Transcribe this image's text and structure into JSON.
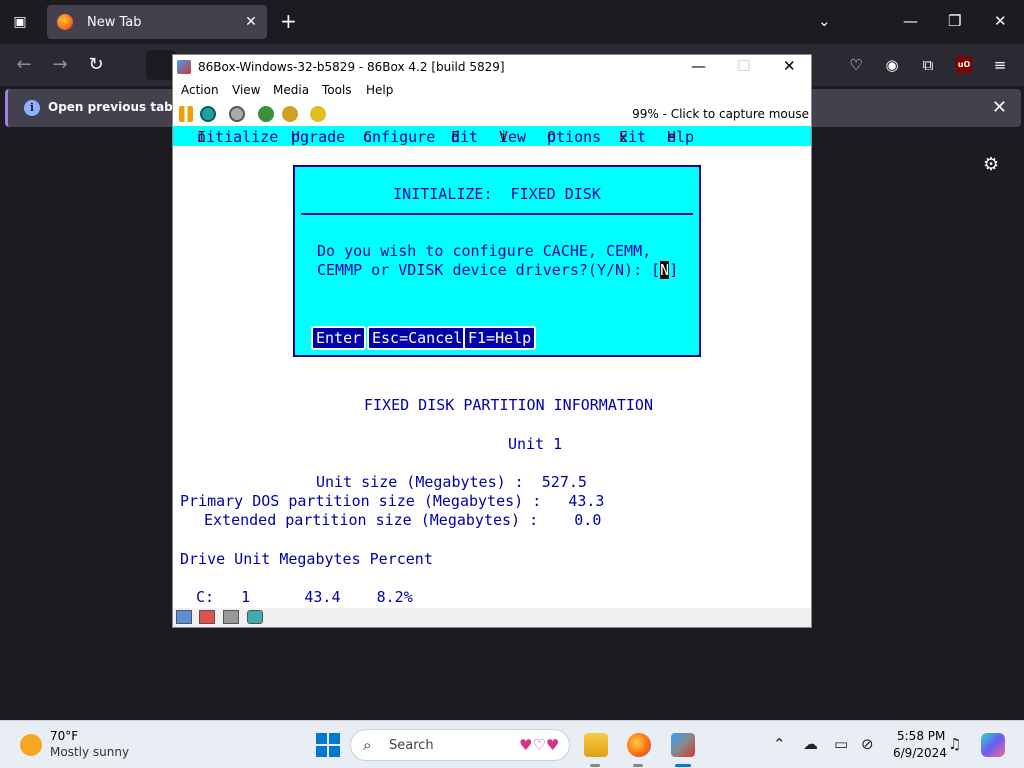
{
  "browser": {
    "tab_title": "New Tab",
    "tab_close": "✕",
    "new_tab": "+",
    "notification": "Open previous tabs? You",
    "notification_close": "✕"
  },
  "vm": {
    "title": "86Box-Windows-32-b5829 - 86Box 4.2 [build 5829]",
    "menu": [
      "Action",
      "View",
      "Media",
      "Tools",
      "Help"
    ],
    "capture_text": "99% - Click to capture mouse"
  },
  "dos": {
    "menu": [
      {
        "hot": "I",
        "rest": "nitialize"
      },
      {
        "hot": "U",
        "rest": "pgrade"
      },
      {
        "hot": "C",
        "rest": "onfigure"
      },
      {
        "hot": "E",
        "rest": "dit"
      },
      {
        "hot": "V",
        "rest": "iew"
      },
      {
        "hot": "O",
        "rest": "ptions"
      },
      {
        "hot": "E",
        "rest": "xit"
      },
      {
        "hot": "H",
        "rest": "elp"
      }
    ],
    "dialog": {
      "title": "INITIALIZE:  FIXED DISK",
      "line1": "Do you wish to configure CACHE, CEMM,",
      "line2_prefix": "CEMMP or VDISK device drivers?(Y/N): [",
      "cursor_value": "N",
      "line2_suffix": "]",
      "buttons": [
        "Enter",
        "Esc=Cancel",
        "F1=Help"
      ]
    },
    "partition_header": "FIXED DISK PARTITION INFORMATION",
    "unit": "Unit 1",
    "rows": [
      "Unit size (Megabytes) :  527.5",
      "Primary DOS partition size (Megabytes) :   43.3",
      "Extended partition size (Megabytes) :    0.0"
    ],
    "table_header": "Drive Unit Megabytes Percent",
    "table_row": "C:   1      43.4    8.2%"
  },
  "taskbar": {
    "temperature": "70°F",
    "weather": "Mostly sunny",
    "search_placeholder": "Search",
    "time": "5:58 PM",
    "date": "6/9/2024"
  },
  "colors": {
    "dos_cyan": "#00ffff",
    "dos_blue": "#0000aa",
    "dos_red": "#aa0000",
    "browser_dark": "#1c1b22"
  }
}
